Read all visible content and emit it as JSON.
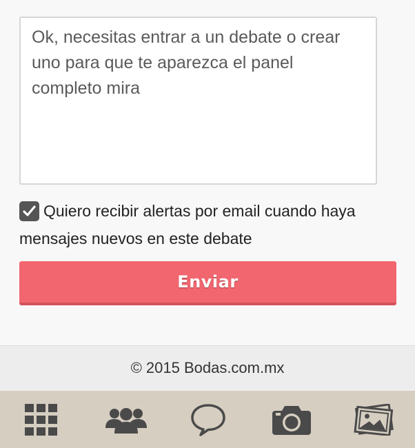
{
  "form": {
    "message_value": "Ok, necesitas entrar a un debate o crear uno para que te aparezca el panel completo mira",
    "alert_checked": true,
    "alert_label": "Quiero recibir alertas por email cuando haya mensajes nuevos en este debate",
    "submit_label": "Enviar"
  },
  "footer": {
    "copyright": "© 2015 Bodas.com.mx"
  },
  "tabbar": {
    "items": [
      {
        "icon": "grid-icon"
      },
      {
        "icon": "community-icon"
      },
      {
        "icon": "chat-bubble-icon"
      },
      {
        "icon": "camera-icon"
      },
      {
        "icon": "photos-icon"
      }
    ]
  },
  "colors": {
    "accent": "#f1666f",
    "tabbar_bg": "#d6cec1",
    "icon": "#4a4a4a"
  }
}
